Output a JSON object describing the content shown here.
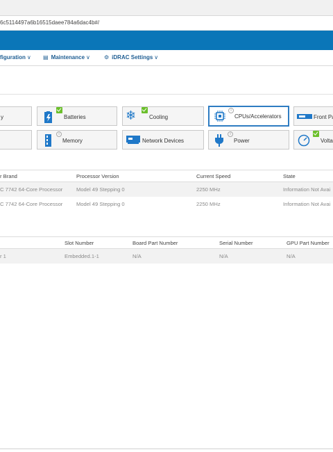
{
  "browser": {
    "url_fragment": "6c5114497a6b16515daee784a6dac4b#/"
  },
  "nav": {
    "items": [
      {
        "label": "figuration",
        "chevron": "chevron-down-icon"
      },
      {
        "label": "Maintenance",
        "chevron": "chevron-down-icon"
      },
      {
        "label": "iDRAC Settings",
        "chevron": "chevron-down-icon"
      }
    ]
  },
  "tiles": {
    "row1": [
      {
        "label": "y"
      },
      {
        "label": "Batteries",
        "status": "ok"
      },
      {
        "label": "Cooling",
        "status": "ok"
      },
      {
        "label": "CPUs/Accelerators",
        "status": "info",
        "selected": true
      },
      {
        "label": "Front Pa"
      }
    ],
    "row2": [
      {
        "label": ""
      },
      {
        "label": "Memory",
        "status": "info"
      },
      {
        "label": "Network Devices"
      },
      {
        "label": "Power",
        "status": "info"
      },
      {
        "label": "Volta",
        "status": "ok"
      }
    ]
  },
  "cpu_table": {
    "headers": [
      "r Brand",
      "Processor Version",
      "Current Speed",
      "State"
    ],
    "rows": [
      [
        "C 7742 64-Core Processor",
        "Model 49 Stepping 0",
        "2250 MHz",
        "Information Not Avai"
      ],
      [
        "C 7742 64-Core Processor",
        "Model 49 Stepping 0",
        "2250 MHz",
        "Information Not Avai"
      ]
    ]
  },
  "gpu_table": {
    "headers": [
      "Slot Number",
      "Board Part Number",
      "Serial Number",
      "GPU Part Number"
    ],
    "rows": [
      [
        "r 1",
        "Embedded.1-1",
        "N/A",
        "N/A",
        "N/A"
      ]
    ]
  },
  "colors": {
    "accent_blue": "#0a76b8",
    "ok_green": "#6bbf2b",
    "selected_border": "#2e7cc2"
  }
}
